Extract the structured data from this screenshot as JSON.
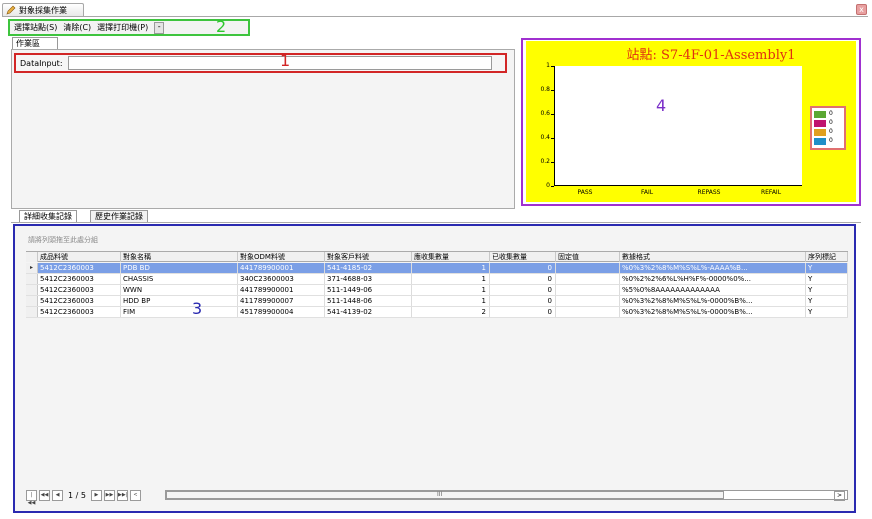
{
  "window": {
    "title": "對象採集作業",
    "close": "x"
  },
  "menu": {
    "items": [
      "選擇站點(S)",
      "清除(C)",
      "選擇打印機(P)"
    ],
    "dropdown": "-",
    "annotation": "2"
  },
  "work_area": {
    "tab": "作業區",
    "data_input_label": "DataInput:",
    "data_input_value": "",
    "annotation": "1"
  },
  "chart_panel": {
    "annotation": "4",
    "colors": {
      "background": "#ffff00",
      "title": "#e03010"
    },
    "chart_data": {
      "type": "bar",
      "title": "站點: S7-4F-01-Assembly1",
      "categories": [
        "PASS",
        "FAIL",
        "REPASS",
        "REFAIL"
      ],
      "values": [
        0,
        0,
        0,
        0
      ],
      "ylim": [
        0,
        1
      ],
      "yticks": [
        "0",
        "0.2",
        "0.4",
        "0.6",
        "0.8",
        "1"
      ],
      "legend": {
        "position": "right",
        "entries": [
          {
            "color": "#5aa832",
            "value": "0"
          },
          {
            "color": "#c0146e",
            "value": "0"
          },
          {
            "color": "#e0a020",
            "value": "0"
          },
          {
            "color": "#1e8fc8",
            "value": "0"
          }
        ]
      }
    }
  },
  "lower_tabs": [
    "詳細收集記錄",
    "歷史作業記錄"
  ],
  "grid": {
    "annotation": "3",
    "group_hint": "請將列頭拖至此處分組",
    "columns": [
      "成品料號",
      "對象名稱",
      "對象ODM料號",
      "對象客戶料號",
      "應收集數量",
      "已收集數量",
      "固定值",
      "數據格式",
      "序列標記"
    ],
    "rows": [
      [
        "5412C2360003",
        "PDB BD",
        "441789900001",
        "541-4185-02",
        "1",
        "0",
        "",
        "%0%3%2%8%M%S%L%-AAAA%B...",
        "Y"
      ],
      [
        "5412C2360003",
        "CHASSIS",
        "340C23600003",
        "371-4688-03",
        "1",
        "0",
        "",
        "%0%2%2%6%L%H%F%-0000%0%...",
        "Y"
      ],
      [
        "5412C2360003",
        "WWN",
        "441789900001",
        "511-1449-06",
        "1",
        "0",
        "",
        "%5%0%8AAAAAAAAAAAAA",
        "Y"
      ],
      [
        "5412C2360003",
        "HDD BP",
        "411789900007",
        "511-1448-06",
        "1",
        "0",
        "",
        "%0%3%2%8%M%S%L%-0000%B%...",
        "Y"
      ],
      [
        "5412C2360003",
        "FIM",
        "451789900004",
        "541-4139-02",
        "2",
        "0",
        "",
        "%0%3%2%8%M%S%L%-0000%B%...",
        "Y"
      ]
    ],
    "selected_row": 0
  },
  "pager": {
    "page_text": "1 / 5",
    "scroll_mid": "III",
    "scroll_right": ">"
  }
}
